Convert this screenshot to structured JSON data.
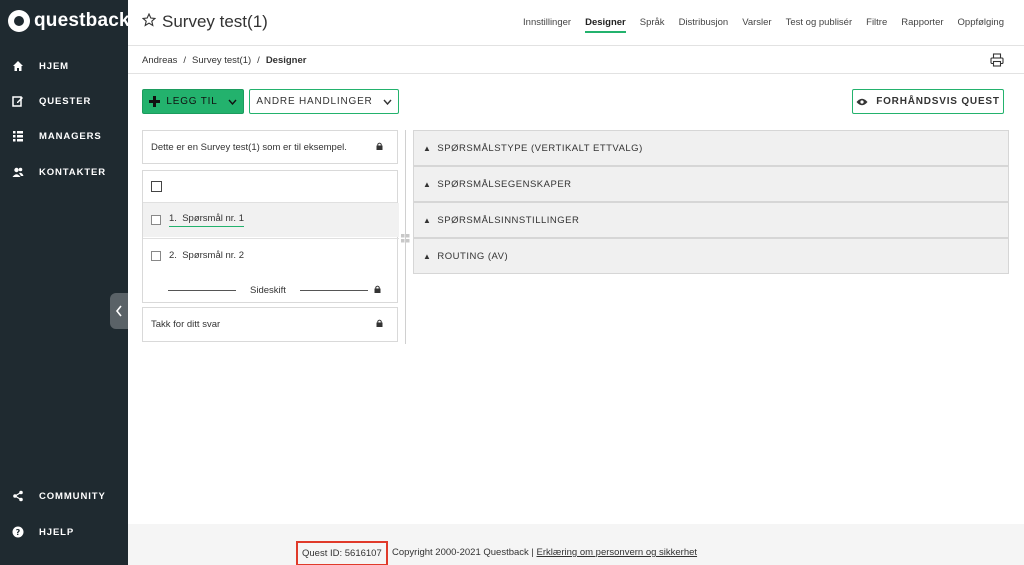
{
  "sidebar": {
    "logo_text": "questback",
    "items": [
      {
        "label": "HJEM",
        "icon": "home-icon"
      },
      {
        "label": "QUESTER",
        "icon": "edit-icon"
      },
      {
        "label": "MANAGERS",
        "icon": "list-icon"
      },
      {
        "label": "KONTAKTER",
        "icon": "contacts-icon"
      }
    ],
    "bottom_items": [
      {
        "label": "COMMUNITY",
        "icon": "share-icon"
      },
      {
        "label": "HJELP",
        "icon": "help-icon"
      }
    ]
  },
  "header": {
    "title": "Survey test(1)",
    "nav": [
      {
        "label": "Innstillinger",
        "active": false
      },
      {
        "label": "Designer",
        "active": true
      },
      {
        "label": "Språk",
        "active": false
      },
      {
        "label": "Distribusjon",
        "active": false
      },
      {
        "label": "Varsler",
        "active": false
      },
      {
        "label": "Test og publisér",
        "active": false
      },
      {
        "label": "Filtre",
        "active": false
      },
      {
        "label": "Rapporter",
        "active": false
      },
      {
        "label": "Oppfølging",
        "active": false
      }
    ]
  },
  "breadcrumb": {
    "items": [
      "Andreas",
      "Survey test(1)"
    ],
    "separator": "/",
    "current": "Designer"
  },
  "toolbar": {
    "add_label": "LEGG TIL",
    "more_label": "ANDRE HANDLINGER",
    "preview_label": "FORHÅNDSVIS QUEST"
  },
  "survey": {
    "intro_text": "Dette er en Survey test(1) som er til eksempel.",
    "questions": [
      {
        "number": "1.",
        "label": "Spørsmål nr. 1",
        "selected": true
      },
      {
        "number": "2.",
        "label": "Spørsmål nr. 2",
        "selected": false
      }
    ],
    "page_break_label": "Sideskift",
    "end_text": "Takk for ditt svar"
  },
  "properties": {
    "sections": [
      "SPØRSMÅLSTYPE (VERTIKALT ETTVALG)",
      "SPØRSMÅLSEGENSKAPER",
      "SPØRSMÅLSINNSTILLINGER",
      "ROUTING (AV)"
    ]
  },
  "footer": {
    "quest_id": "Quest ID: 5616107",
    "copyright": "Copyright 2000-2021 Questback",
    "separator": "|",
    "privacy_link": "Erklæring om personvern og sikkerhet"
  },
  "colors": {
    "sidebar_bg": "#1f2a30",
    "accent_green": "#23b26d",
    "highlight_red": "#e03a2a"
  }
}
